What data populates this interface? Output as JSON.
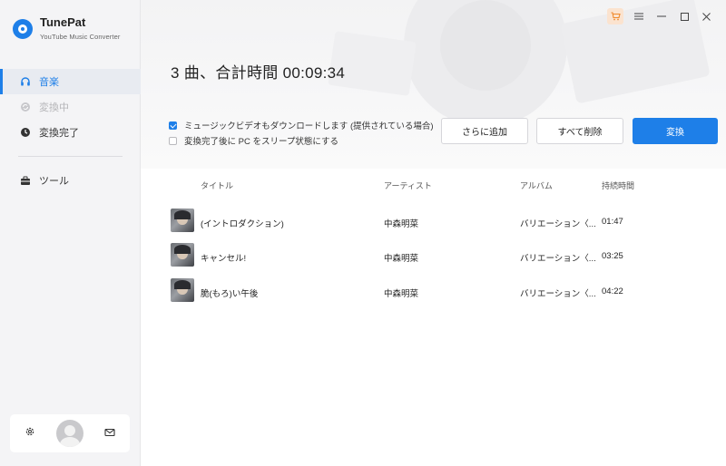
{
  "app": {
    "name": "TunePat",
    "subtitle": "YouTube Music Converter"
  },
  "sidebar": {
    "items": [
      {
        "label": "音楽",
        "icon": "headphones-icon",
        "state": "active"
      },
      {
        "label": "変換中",
        "icon": "sync-icon",
        "state": "disabled"
      },
      {
        "label": "変換完了",
        "icon": "clock-icon",
        "state": "normal"
      },
      {
        "label": "ツール",
        "icon": "toolbox-icon",
        "state": "normal"
      }
    ]
  },
  "header": {
    "title": "3 曲、合計時間 00:09:34"
  },
  "options": [
    {
      "label": "ミュージックビデオもダウンロードします (提供されている場合)",
      "checked": true
    },
    {
      "label": "変換完了後に PC をスリープ状態にする",
      "checked": false
    }
  ],
  "toolbar": {
    "add_label": "さらに追加",
    "delete_all_label": "すべて削除",
    "convert_label": "変換"
  },
  "table": {
    "columns": [
      "タイトル",
      "アーティスト",
      "アルバム",
      "持続時間"
    ],
    "rows": [
      {
        "title": "(イントロダクション)",
        "artist": "中森明菜",
        "album": "バリエーション〈...",
        "duration": "01:47"
      },
      {
        "title": "キャンセル!",
        "artist": "中森明菜",
        "album": "バリエーション〈...",
        "duration": "03:25"
      },
      {
        "title": "脆(もろ)い午後",
        "artist": "中森明菜",
        "album": "バリエーション〈...",
        "duration": "04:22"
      }
    ]
  },
  "colors": {
    "accent": "#1e7fe8",
    "sidebar_bg": "#f4f4f6"
  }
}
